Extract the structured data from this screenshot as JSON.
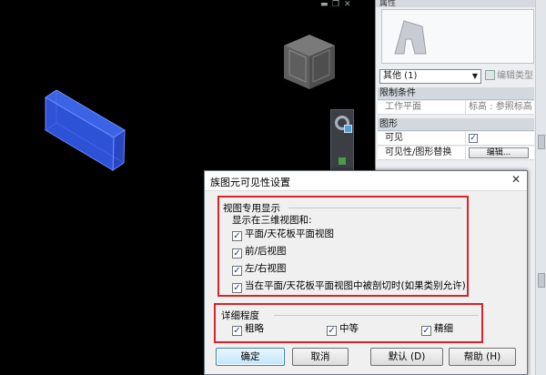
{
  "properties": {
    "title": "属性",
    "type_selector": "其他 (1)",
    "edit_type": "编辑类型",
    "categories": [
      {
        "label": "限制条件",
        "rows": [
          {
            "name": "工作平面",
            "value": "标高 : 参照标高"
          }
        ]
      },
      {
        "label": "图形",
        "rows": [
          {
            "name": "可见",
            "value": "✓"
          },
          {
            "name": "可见性/图形替换",
            "value": "编辑..."
          }
        ]
      }
    ]
  },
  "dialog": {
    "title": "族图元可见性设置",
    "close": "✕",
    "view_group": {
      "label": "视图专用显示",
      "sublabel": "显示在三维视图和:",
      "options": [
        {
          "label": "平面/天花板平面视图",
          "checked": "✓"
        },
        {
          "label": "前/后视图",
          "checked": "✓"
        },
        {
          "label": "左/右视图",
          "checked": "✓"
        },
        {
          "label": "当在平面/天花板平面视图中被剖切时(如果类别允许)",
          "checked": "✓"
        }
      ]
    },
    "detail_group": {
      "label": "详细程度",
      "options": [
        {
          "label": "粗略",
          "checked": "✓"
        },
        {
          "label": "中等",
          "checked": "✓"
        },
        {
          "label": "精细",
          "checked": "✓"
        }
      ]
    },
    "buttons": {
      "ok": "确定",
      "cancel": "取消",
      "default": "默认 (D)",
      "help": "帮助 (H)"
    }
  },
  "colors": {
    "accent_red": "#d8232a",
    "box_blue": "#2e52d6",
    "viewport": "#000000"
  },
  "icons": [
    "window-minimize-icon",
    "window-restore-icon",
    "window-close-icon",
    "viewcube-icon",
    "steering-wheel-icon",
    "family-preview-icon",
    "edit-type-icon"
  ]
}
